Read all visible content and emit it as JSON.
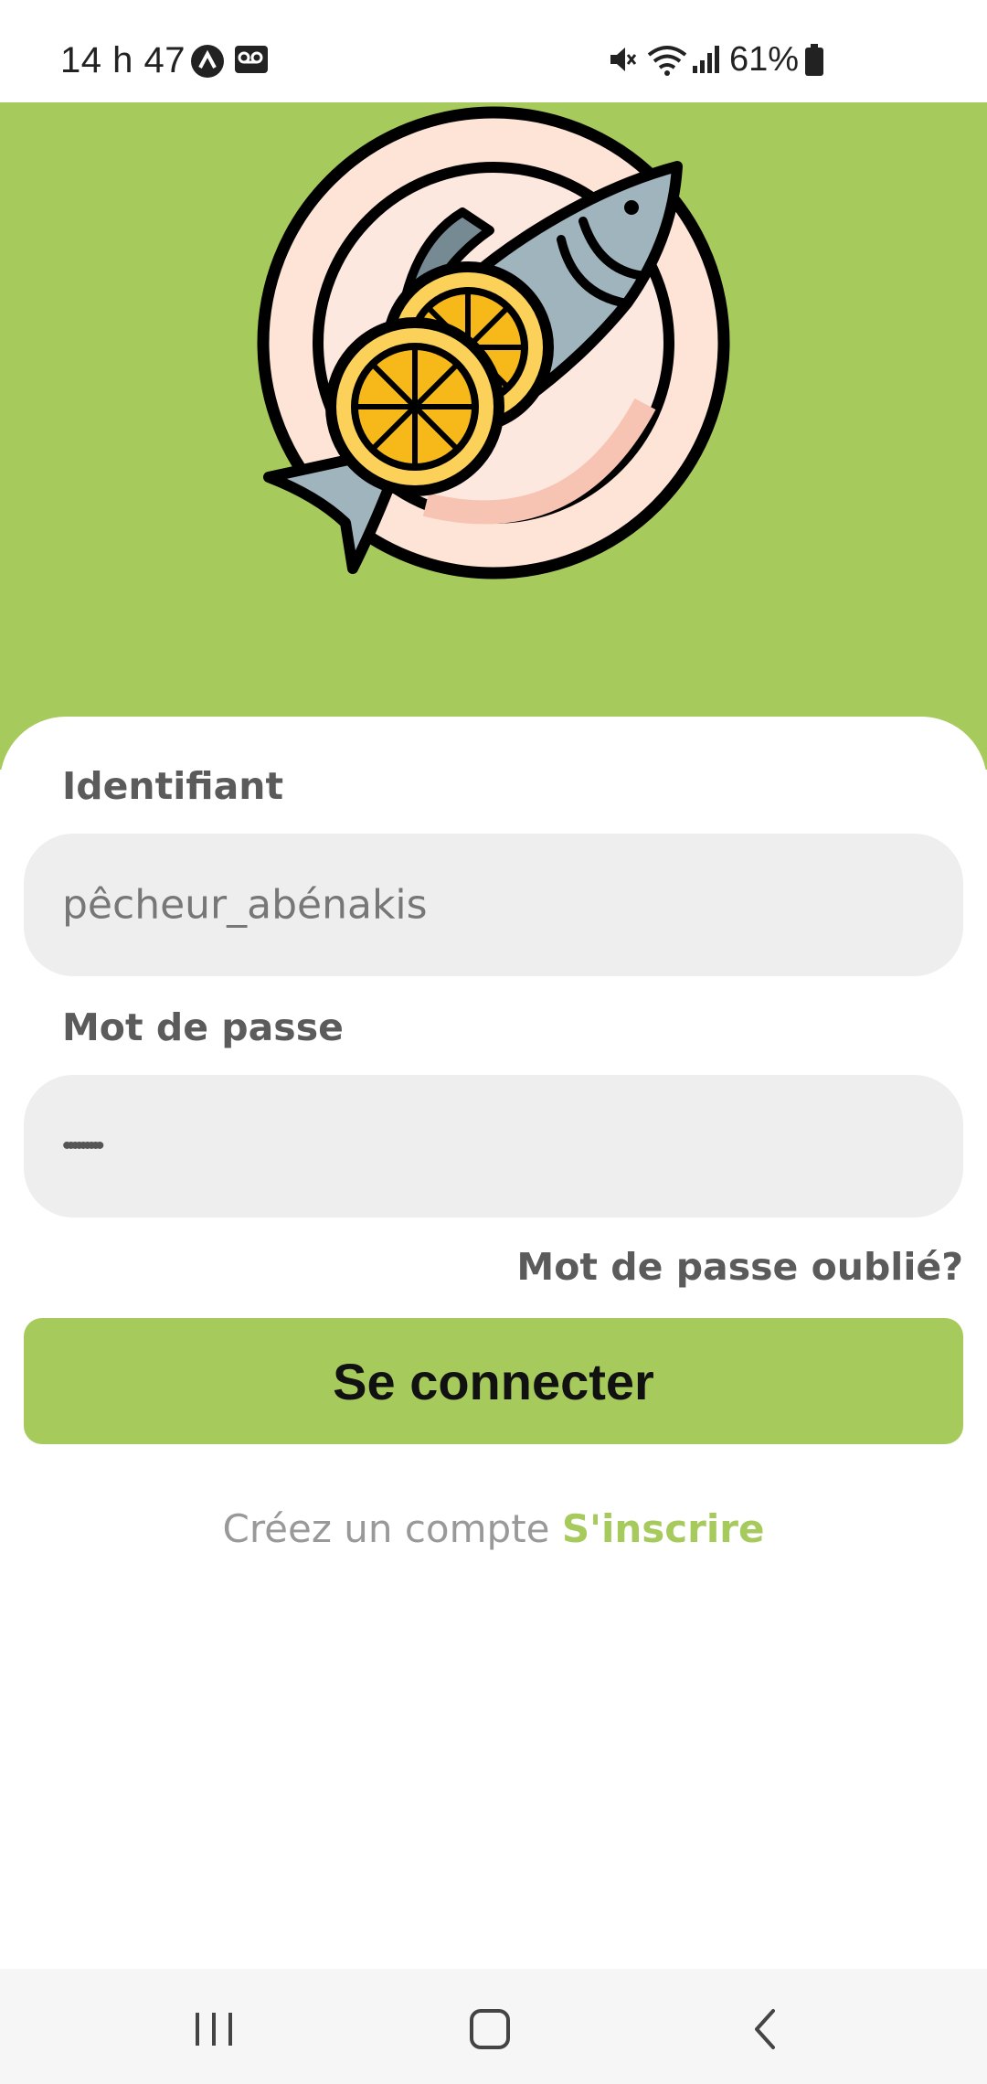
{
  "status_bar": {
    "time": "14 h 47",
    "battery": "61%",
    "icons": [
      "app-icon",
      "voicemail-icon",
      "mute-icon",
      "wifi-icon",
      "signal-icon",
      "battery-icon"
    ]
  },
  "login": {
    "username_label": "Identifiant",
    "username_value": "pêcheur_abénakis",
    "password_label": "Mot de passe",
    "password_value": "•••••••••",
    "forgot_label": "Mot de passe oublié?",
    "submit_label": "Se connecter",
    "signup_prompt": "Créez un compte",
    "signup_link": "S'inscrire"
  },
  "colors": {
    "accent": "#a6ca5b",
    "label": "#5b5b5b",
    "field_bg": "#eeeeee"
  },
  "nav": {
    "icons": [
      "recent-apps-icon",
      "home-icon",
      "back-icon"
    ]
  }
}
